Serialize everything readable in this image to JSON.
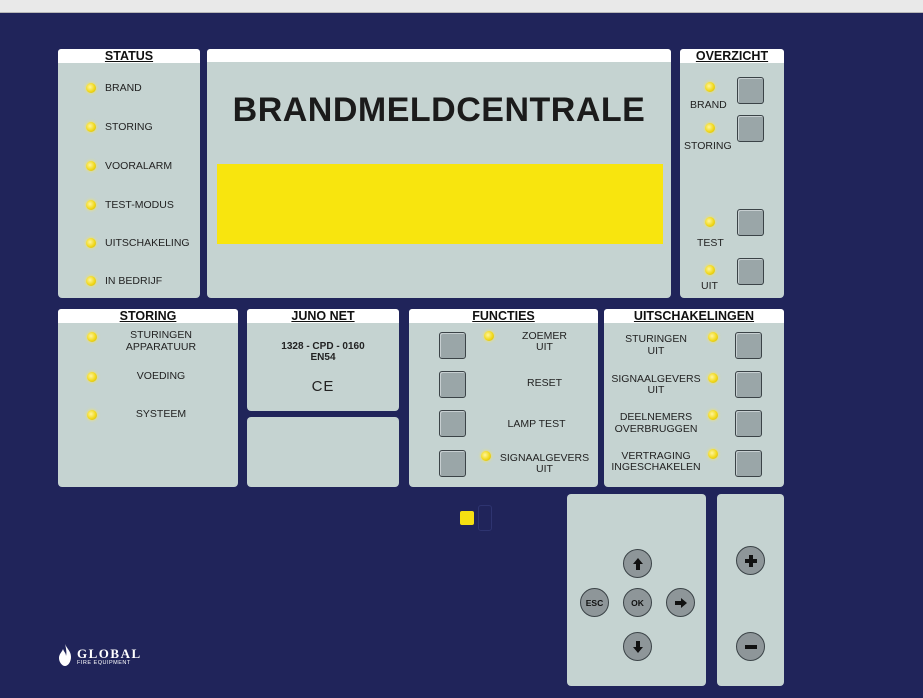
{
  "status": {
    "header": "STATUS",
    "items": [
      "BRAND",
      "STORING",
      "VOORALARM",
      "TEST-MODUS",
      "UITSCHAKELING",
      "IN BEDRIJF"
    ]
  },
  "main": {
    "title": "BRANDMELDCENTRALE"
  },
  "overzicht": {
    "header": "OVERZICHT",
    "items": [
      "BRAND",
      "STORING",
      "TEST",
      "UIT"
    ]
  },
  "storing": {
    "header": "STORING",
    "items": [
      {
        "line1": "STURINGEN",
        "line2": "APPARATUUR"
      },
      {
        "line1": "VOEDING",
        "line2": ""
      },
      {
        "line1": "SYSTEEM",
        "line2": ""
      }
    ]
  },
  "juno": {
    "header": "JUNO NET",
    "cert": "1328 - CPD - 0160",
    "standard": "EN54",
    "mark": "CE"
  },
  "functies": {
    "header": "FUNCTIES",
    "items": [
      {
        "line1": "ZOEMER",
        "line2": "UIT"
      },
      {
        "line1": "RESET",
        "line2": ""
      },
      {
        "line1": "LAMP TEST",
        "line2": ""
      },
      {
        "line1": "SIGNAALGEVERS",
        "line2": "UIT"
      }
    ]
  },
  "uitschakelingen": {
    "header": "UITSCHAKELINGEN",
    "items": [
      {
        "line1": "STURINGEN",
        "line2": "UIT"
      },
      {
        "line1": "SIGNAALGEVERS",
        "line2": "UIT"
      },
      {
        "line1": "DEELNEMERS",
        "line2": "OVERBRUGGEN"
      },
      {
        "line1": "VERTRAGING",
        "line2": "INGESCHAKELEN"
      }
    ]
  },
  "nav": {
    "esc": "ESC",
    "ok": "OK"
  },
  "brand": {
    "name": "GLOBAL",
    "tagline": "FIRE EQUIPMENT"
  },
  "colors": {
    "background": "#20245a",
    "panel": "#c5d3d1",
    "led": "#f1d81a",
    "display": "#f8e50e"
  }
}
